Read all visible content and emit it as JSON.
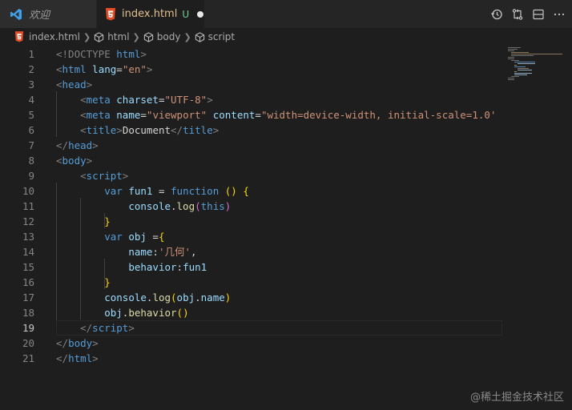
{
  "tabs": {
    "welcome": "欢迎",
    "active": {
      "name": "index.html",
      "status": "U"
    }
  },
  "breadcrumb": [
    "index.html",
    "html",
    "body",
    "script"
  ],
  "editor": {
    "current_line": 19,
    "lines": [
      {
        "n": "1",
        "segs": [
          [
            "<!DOCTYPE ",
            "tag"
          ],
          [
            "html",
            "name"
          ],
          [
            ">",
            "tag"
          ]
        ]
      },
      {
        "n": "2",
        "segs": [
          [
            "<",
            "tag"
          ],
          [
            "html",
            "name"
          ],
          [
            " ",
            "text"
          ],
          [
            "lang",
            "attr"
          ],
          [
            "=",
            "text"
          ],
          [
            "\"en\"",
            "str"
          ],
          [
            ">",
            "tag"
          ]
        ]
      },
      {
        "n": "3",
        "segs": [
          [
            "<",
            "tag"
          ],
          [
            "head",
            "name"
          ],
          [
            ">",
            "tag"
          ]
        ]
      },
      {
        "n": "4",
        "segs": [
          [
            "    ",
            "text"
          ],
          [
            "<",
            "tag"
          ],
          [
            "meta",
            "name"
          ],
          [
            " ",
            "text"
          ],
          [
            "charset",
            "attr"
          ],
          [
            "=",
            "text"
          ],
          [
            "\"UTF-8\"",
            "str"
          ],
          [
            ">",
            "tag"
          ]
        ]
      },
      {
        "n": "5",
        "segs": [
          [
            "    ",
            "text"
          ],
          [
            "<",
            "tag"
          ],
          [
            "meta",
            "name"
          ],
          [
            " ",
            "text"
          ],
          [
            "name",
            "attr"
          ],
          [
            "=",
            "text"
          ],
          [
            "\"viewport\"",
            "str"
          ],
          [
            " ",
            "text"
          ],
          [
            "content",
            "attr"
          ],
          [
            "=",
            "text"
          ],
          [
            "\"width=device-width, initial-scale=1.0'",
            "str"
          ]
        ]
      },
      {
        "n": "6",
        "segs": [
          [
            "    ",
            "text"
          ],
          [
            "<",
            "tag"
          ],
          [
            "title",
            "name"
          ],
          [
            ">",
            "tag"
          ],
          [
            "Document",
            "text"
          ],
          [
            "</",
            "tag"
          ],
          [
            "title",
            "name"
          ],
          [
            ">",
            "tag"
          ]
        ]
      },
      {
        "n": "7",
        "segs": [
          [
            "</",
            "tag"
          ],
          [
            "head",
            "name"
          ],
          [
            ">",
            "tag"
          ]
        ]
      },
      {
        "n": "8",
        "segs": [
          [
            "<",
            "tag"
          ],
          [
            "body",
            "name"
          ],
          [
            ">",
            "tag"
          ]
        ]
      },
      {
        "n": "9",
        "segs": [
          [
            "    ",
            "text"
          ],
          [
            "<",
            "tag"
          ],
          [
            "script",
            "name"
          ],
          [
            ">",
            "tag"
          ]
        ]
      },
      {
        "n": "10",
        "segs": [
          [
            "        ",
            "text"
          ],
          [
            "var",
            "kw"
          ],
          [
            " ",
            "text"
          ],
          [
            "fun1",
            "var"
          ],
          [
            " = ",
            "text"
          ],
          [
            "function",
            "kw"
          ],
          [
            " ",
            "text"
          ],
          [
            "()",
            "brace"
          ],
          [
            " ",
            "text"
          ],
          [
            "{",
            "brace"
          ]
        ]
      },
      {
        "n": "11",
        "segs": [
          [
            "            ",
            "text"
          ],
          [
            "console",
            "var"
          ],
          [
            ".",
            "text"
          ],
          [
            "log",
            "fn"
          ],
          [
            "(",
            "paren2"
          ],
          [
            "this",
            "kw"
          ],
          [
            ")",
            "paren2"
          ]
        ]
      },
      {
        "n": "12",
        "segs": [
          [
            "        ",
            "text"
          ],
          [
            "}",
            "brace"
          ]
        ]
      },
      {
        "n": "13",
        "segs": [
          [
            "        ",
            "text"
          ],
          [
            "var",
            "kw"
          ],
          [
            " ",
            "text"
          ],
          [
            "obj",
            "var"
          ],
          [
            " =",
            "text"
          ],
          [
            "{",
            "brace"
          ]
        ]
      },
      {
        "n": "14",
        "segs": [
          [
            "            ",
            "text"
          ],
          [
            "name",
            "var"
          ],
          [
            ":",
            "text"
          ],
          [
            "'几何'",
            "str"
          ],
          [
            ",",
            "text"
          ]
        ]
      },
      {
        "n": "15",
        "segs": [
          [
            "            ",
            "text"
          ],
          [
            "behavior",
            "var"
          ],
          [
            ":",
            "text"
          ],
          [
            "fun1",
            "var"
          ]
        ]
      },
      {
        "n": "16",
        "segs": [
          [
            "        ",
            "text"
          ],
          [
            "}",
            "brace"
          ]
        ]
      },
      {
        "n": "17",
        "segs": [
          [
            "        ",
            "text"
          ],
          [
            "console",
            "var"
          ],
          [
            ".",
            "text"
          ],
          [
            "log",
            "fn"
          ],
          [
            "(",
            "brace"
          ],
          [
            "obj",
            "var"
          ],
          [
            ".",
            "text"
          ],
          [
            "name",
            "var"
          ],
          [
            ")",
            "brace"
          ]
        ]
      },
      {
        "n": "18",
        "segs": [
          [
            "        ",
            "text"
          ],
          [
            "obj",
            "var"
          ],
          [
            ".",
            "text"
          ],
          [
            "behavior",
            "fn"
          ],
          [
            "()",
            "brace"
          ]
        ]
      },
      {
        "n": "19",
        "segs": [
          [
            "    ",
            "text"
          ],
          [
            "</",
            "tag"
          ],
          [
            "script",
            "name"
          ],
          [
            ">",
            "tag"
          ]
        ]
      },
      {
        "n": "20",
        "segs": [
          [
            "</",
            "tag"
          ],
          [
            "body",
            "name"
          ],
          [
            ">",
            "tag"
          ]
        ]
      },
      {
        "n": "21",
        "segs": [
          [
            "</",
            "tag"
          ],
          [
            "html",
            "name"
          ],
          [
            ">",
            "tag"
          ]
        ]
      }
    ]
  },
  "icons": {
    "welcome": "vscode-logo-icon",
    "file": "html5-icon",
    "modified": "dot-icon",
    "actions": [
      "history-icon",
      "compare-changes-icon",
      "split-editor-icon",
      "more-actions-icon"
    ],
    "breadcrumb": "symbol-cube-icon"
  },
  "colors": {
    "background": "#1e1e1e",
    "tabbar": "#252526",
    "accent": "#007acc",
    "modified_name": "#e2c08d",
    "untracked": "#73c991"
  },
  "watermark": "@稀土掘金技术社区"
}
